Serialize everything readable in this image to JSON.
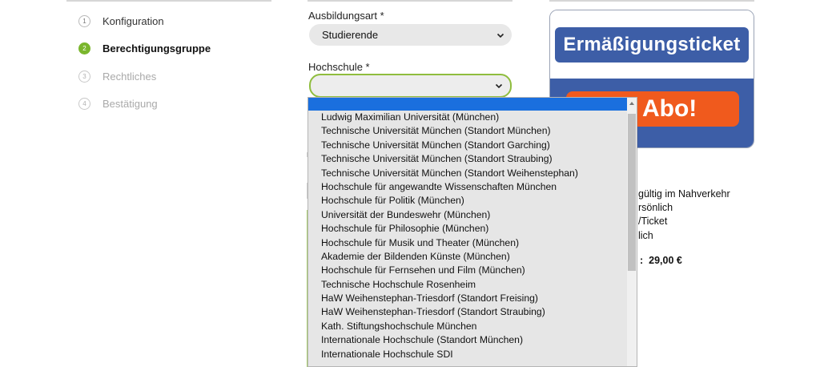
{
  "steps": [
    {
      "num": "1",
      "label": "Konfiguration",
      "state": "done"
    },
    {
      "num": "2",
      "label": "Berechtigungsgruppe",
      "state": "active"
    },
    {
      "num": "3",
      "label": "Rechtliches",
      "state": "disabled"
    },
    {
      "num": "4",
      "label": "Bestätigung",
      "state": "disabled"
    }
  ],
  "form": {
    "ausbildungsart": {
      "label": "Ausbildungsart *",
      "value": "Studierende"
    },
    "hochschule": {
      "label": "Hochschule *",
      "value": ""
    }
  },
  "dropdown": {
    "options": [
      "Ludwig Maximilian Universität (München)",
      "Technische Universität München (Standort München)",
      "Technische Universität München (Standort Garching)",
      "Technische Universität München (Standort Straubing)",
      "Technische Universität München (Standort Weihenstephan)",
      "Hochschule für angewandte Wissenschaften München",
      "Hochschule für Politik (München)",
      "Universität der Bundeswehr (München)",
      "Hochschule für Philosophie (München)",
      "Hochschule für Musik und Theater (München)",
      "Akademie der Bildenden Künste (München)",
      "Hochschule für Fernsehen und Film (München)",
      "Technische Hochschule Rosenheim",
      "HaW Weihenstephan-Triesdorf (Standort Freising)",
      "HaW Weihenstephan-Triesdorf (Standort Straubing)",
      "Kath. Stiftungshochschule München",
      "Internationale Hochschule (Standort München)",
      "Internationale Hochschule SDI"
    ]
  },
  "card": {
    "title": "Ermäßigungsticket",
    "subtitle_visible": "im Abo!"
  },
  "info": {
    "line1": "gültig im Nahverkehr",
    "line2": "rsönlich",
    "line3": "/Ticket",
    "line4": "lich",
    "price_prefix": ":",
    "price_value": "29,00 €"
  },
  "colors": {
    "accent_green": "#7ab62d",
    "card_blue": "#3d5ea7",
    "card_orange": "#f05a1d",
    "highlight_blue": "#1a6fde"
  }
}
